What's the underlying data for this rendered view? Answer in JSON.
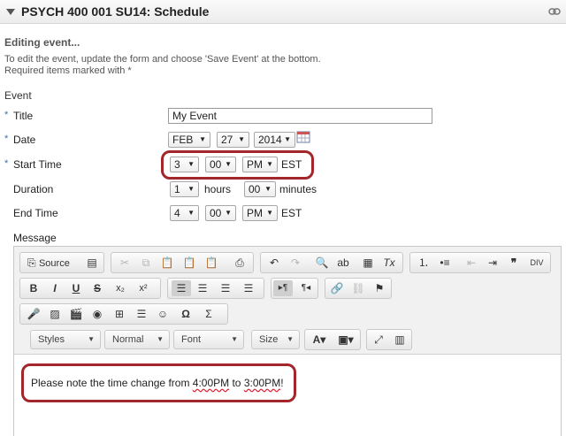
{
  "header": {
    "title": "PSYCH 400 001 SU14: Schedule"
  },
  "form": {
    "heading": "Editing event...",
    "instructions_1": "To edit the event, update the form and choose 'Save Event' at the bottom.",
    "instructions_2": "Required items marked with *",
    "section_label": "Event",
    "required_mark": "*",
    "title_label": "Title",
    "title_value": "My Event",
    "date_label": "Date",
    "date_month": "FEB",
    "date_day": "27",
    "date_year": "2014",
    "start_label": "Start Time",
    "start_hour": "3",
    "start_min": "00",
    "start_ampm": "PM",
    "start_tz": "EST",
    "duration_label": "Duration",
    "duration_hours": "1",
    "hours_label": "hours",
    "duration_minutes": "00",
    "minutes_label": "minutes",
    "end_label": "End Time",
    "end_hour": "4",
    "end_min": "00",
    "end_ampm": "PM",
    "end_tz": "EST",
    "message_label": "Message"
  },
  "editor": {
    "source_label": "Source",
    "styles": "Styles",
    "format": "Normal",
    "font": "Font",
    "size": "Size",
    "content_prefix": "Please note the time change from ",
    "content_time1": "4:00PM",
    "content_mid": " to ",
    "content_time2": "3:00PM",
    "content_suffix": "!"
  },
  "colors": {
    "highlight": "#a3262a",
    "required_star": "#3b6fae"
  }
}
